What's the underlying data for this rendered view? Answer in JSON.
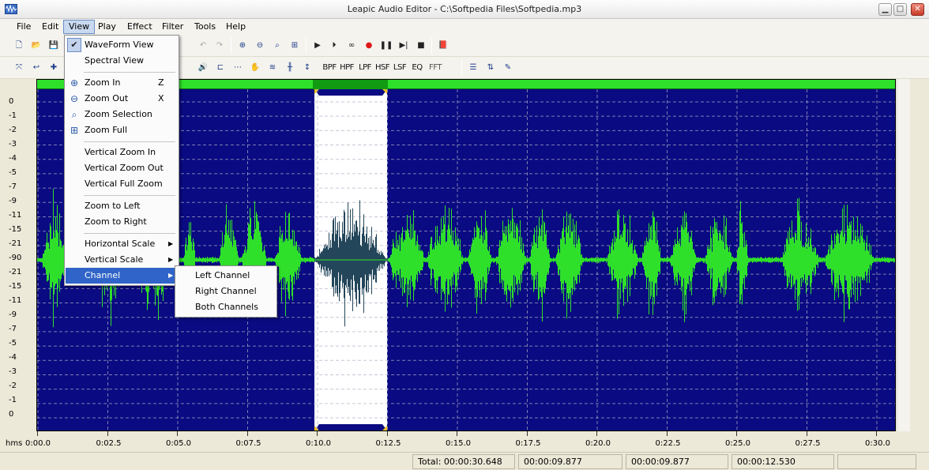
{
  "window": {
    "title": "Leapic Audio Editor - C:\\Softpedia Files\\Softpedia.mp3"
  },
  "menubar": [
    "File",
    "Edit",
    "View",
    "Play",
    "Effect",
    "Filter",
    "Tools",
    "Help"
  ],
  "view_menu": {
    "waveform_view": "WaveForm View",
    "spectral_view": "Spectral View",
    "zoom_in": "Zoom In",
    "zoom_in_key": "Z",
    "zoom_out": "Zoom Out",
    "zoom_out_key": "X",
    "zoom_selection": "Zoom Selection",
    "zoom_full": "Zoom Full",
    "vertical_zoom_in": "Vertical Zoom In",
    "vertical_zoom_out": "Vertical Zoom Out",
    "vertical_full_zoom": "Vertical Full Zoom",
    "zoom_to_left": "Zoom to Left",
    "zoom_to_right": "Zoom to Right",
    "horizontal_scale": "Horizontal Scale",
    "vertical_scale": "Vertical Scale",
    "channel": "Channel"
  },
  "channel_submenu": [
    "Left Channel",
    "Right Channel",
    "Both Channels"
  ],
  "filter_buttons": [
    "BPF",
    "HPF",
    "LPF",
    "HSF",
    "LSF",
    "EQ",
    "FFT"
  ],
  "db_scale": [
    "0",
    "-1",
    "-2",
    "-3",
    "-4",
    "-5",
    "-7",
    "-9",
    "-11",
    "-15",
    "-21",
    "-90",
    "-21",
    "-15",
    "-11",
    "-9",
    "-7",
    "-5",
    "-4",
    "-3",
    "-2",
    "-1",
    "0"
  ],
  "time_axis": {
    "unit": "hms",
    "labels": [
      "0:00.0",
      "0:02.5",
      "0:05.0",
      "0:07.5",
      "0:10.0",
      "0:12.5",
      "0:15.0",
      "0:17.5",
      "0:20.0",
      "0:22.5",
      "0:25.0",
      "0:27.5",
      "0:30.0"
    ]
  },
  "status": {
    "total": "Total: 00:00:30.648",
    "start": "00:00:09.877",
    "end": "00:00:09.877",
    "length": "00:00:12.530"
  },
  "colors": {
    "wave_bg": "#0a0a82",
    "wave_fg": "#2fe02a",
    "selection_bg": "#ffffff",
    "selection_wave": "#23465a",
    "menu_highlight": "#3064c8"
  }
}
